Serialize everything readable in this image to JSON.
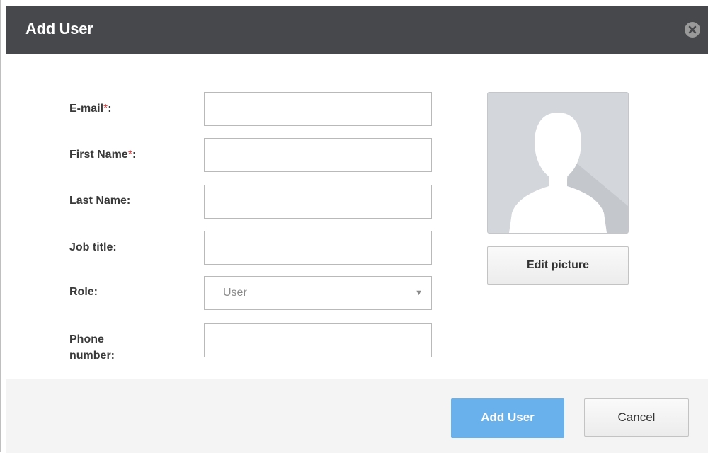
{
  "dialog": {
    "title": "Add User",
    "close_icon": "close-circle-icon"
  },
  "form": {
    "email": {
      "label": "E-mail",
      "required_mark": "*",
      "suffix": ":",
      "value": "",
      "placeholder": ""
    },
    "first_name": {
      "label": "First Name",
      "required_mark": "*",
      "suffix": ":",
      "value": "",
      "placeholder": ""
    },
    "last_name": {
      "label": "Last Name:",
      "value": "",
      "placeholder": ""
    },
    "job_title": {
      "label": "Job title:",
      "value": "",
      "placeholder": ""
    },
    "role": {
      "label": "Role:",
      "selected": "User",
      "arrow_icon": "dropdown-arrow-icon"
    },
    "phone": {
      "label_line1": "Phone",
      "label_line2": "number:",
      "value": "",
      "placeholder": ""
    }
  },
  "picture": {
    "avatar_icon": "user-silhouette-icon",
    "edit_label": "Edit picture"
  },
  "footer": {
    "add_label": "Add User",
    "cancel_label": "Cancel"
  },
  "colors": {
    "header_bg": "#46484b",
    "primary_button": "#68b1ec",
    "required_mark": "#d63b3b"
  }
}
